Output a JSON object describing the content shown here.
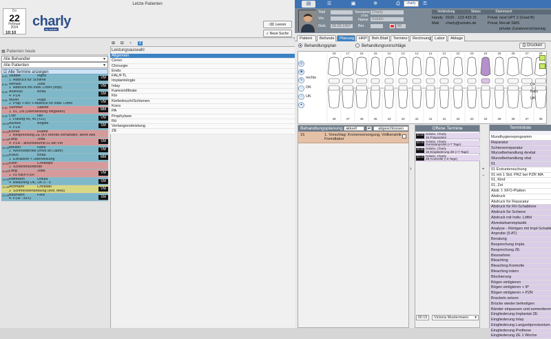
{
  "left_pane": {
    "title": "Letzte Patienten",
    "calendar": {
      "dow": "Do",
      "day": "22",
      "month": "Februar",
      "year": "2024"
    },
    "clock": "10:10",
    "logo": "charly",
    "logo_sub": "by solutio",
    "buttons": {
      "clear": "Leeren",
      "new_search": "Neue Suche"
    },
    "patients_today_label": "Patienten heute",
    "treater_filter": "Alle Behandler",
    "patient_filter": "Alle Patienten",
    "all_appointments_label": "Alle Termine anzeigen",
    "appointments": [
      {
        "time": "8:00",
        "last": "Stubbe",
        "first": "Ingrid",
        "num": "1",
        "desc": "Abdruck für Schiene",
        "code": "VM",
        "color": "b"
      },
      {
        "time": "8:30",
        "last": "Wenzel",
        "first": "Jutta",
        "num": "1",
        "desc": "Abdruck mit Indiv. Löffel (Impl)",
        "code": "VM",
        "color": "b"
      },
      {
        "time": "8:45",
        "last": "Andreas",
        "first": "Britta",
        "num": "4",
        "desc": "PZR",
        "code": "SM",
        "color": "b"
      },
      {
        "time": "9:00",
        "last": "Müller",
        "first": "Hugo",
        "num": "2",
        "desc": "Präp + eKr + Abdruck für indiv. Löffel",
        "code": "VM",
        "color": "b"
      },
      {
        "time": "9:30",
        "last": "Sommer",
        "first": "Sabine",
        "num": "1",
        "desc": "01, Zst (Überweisung mitgeben)",
        "code": "MM",
        "color": "r"
      },
      {
        "time": "9:45",
        "last": "Lutz",
        "first": "Ilse",
        "num": "1",
        "desc": "Füllung 46, 45 (+22)",
        "code": "VM",
        "color": "b"
      },
      {
        "time": "10:00",
        "last": "Aichele",
        "first": "Brigitte",
        "num": "4",
        "desc": "PZR",
        "code": "SM",
        "color": "b"
      },
      {
        "time": "10:00",
        "last": "Körner",
        "first": "Rudolf",
        "num": "1",
        "desc": "Besprechung ZE (KV bereits vorhanden, siehe Aktuell)",
        "code": "",
        "color": "r"
      },
      {
        "time": "10:30",
        "last": "Lang",
        "first": "Jutta",
        "num": "4",
        "desc": "PZR - anschließend 01 bei VM",
        "code": "SM",
        "color": "r"
      },
      {
        "time": "10:45",
        "last": "Meister",
        "first": "Hans",
        "num": "2",
        "desc": "Wechselprobe (Infos an Labor)",
        "code": "VM",
        "color": "b"
      },
      {
        "time": "11:00",
        "last": "Kraus",
        "first": "Britta",
        "num": "1",
        "desc": "Extraktion + Überweisung",
        "code": "MM",
        "color": "b"
      },
      {
        "time": "11:30",
        "last": "Klein",
        "first": "Christoph",
        "num": "1",
        "desc": "Schienenkontrolle",
        "code": "",
        "color": "r"
      },
      {
        "time": "11:45",
        "last": "Lang",
        "first": "Jutta",
        "num": "1",
        "desc": "01 nach PZR",
        "code": "VM",
        "color": "r"
      },
      {
        "time": "12:00",
        "last": "Hoffmann",
        "first": "Ursula",
        "num": "4",
        "desc": "Bleaching OK, UK 5 - 5",
        "code": "SM",
        "color": "b"
      },
      {
        "time": "12:30",
        "last": "Achmann",
        "first": "Christian",
        "num": "2",
        "desc": "Schmerzbehandlung (evtl. Med)",
        "code": "VM",
        "color": "y"
      },
      {
        "time": "12:45",
        "last": "Baumann",
        "first": "Felix",
        "num": "4",
        "desc": "PZR - KFO",
        "code": "SM",
        "color": "b"
      }
    ],
    "service_header": "Leistungsauswahl",
    "services": [
      "Allgemein",
      "Cerec",
      "Chirurgie",
      "Endo",
      "FAL/FTL",
      "Implantologie",
      "Inlay",
      "Kariesinfiltrate",
      "Klo",
      "Kieferbruch/Schienen",
      "Kons",
      "PA",
      "Prophylaxe",
      "Rö",
      "Verlangensleistung",
      "ZE"
    ]
  },
  "right_pane": {
    "charly_label": "charly",
    "patient": {
      "labels": {
        "title": "Titel",
        "first": "Vorname",
        "pre": "Vor.",
        "name": "Name",
        "dob": "Geb.",
        "ber": "Ber."
      },
      "first_name": "Charly",
      "last_name": "Solutio",
      "dob": "08.05.1967",
      "age": "56",
      "patnr": "2730"
    },
    "verbindung": {
      "label": "Verbindung",
      "status": "Status",
      "stamm": "Stammarzt"
    },
    "contact": {
      "handy_label": "Handy",
      "handy": "0100 - 123 433 21",
      "mail_label": "Mail",
      "mail": "charly@solutio.de",
      "ins_right1": "Privat",
      "ins_right2": "Privat",
      "ins_1": "next UPT 2 (Grad B)",
      "ins_2": "Recall SMS",
      "ins_3": "private Zusatzversicherung"
    },
    "tabs": [
      "Patient",
      "Befunde",
      "Planung",
      "HKP",
      "Beh.Blatt",
      "Termine",
      "Rechnung",
      "Labor",
      "Ablage"
    ],
    "active_tab": "Planung",
    "radio_plan": "Behandlungsplan",
    "radio_sugg": "Behandlungsvorschläge",
    "print_label": "Drucken",
    "chart": {
      "upper_teeth": [
        "18",
        "17",
        "16",
        "15",
        "14",
        "13",
        "12",
        "11",
        "21",
        "22",
        "23",
        "24",
        "25",
        "26",
        "27",
        "28"
      ],
      "lower_teeth": [
        "48",
        "47",
        "46",
        "45",
        "44",
        "43",
        "42",
        "41",
        "31",
        "32",
        "33",
        "34",
        "35",
        "36",
        "37",
        "38"
      ],
      "label_ok": "OK",
      "label_uk": "UK",
      "label_rechts": "rechts",
      "label_links": "links",
      "highlight_tooth": "24"
    },
    "plan_panel": {
      "header": "Behandlungsplanung",
      "status": "aktuell",
      "filter": "abgeschlossen",
      "row_num": "15",
      "row_text": "1. Vorschlag: Kronenversorgung, Vollkeramik Fremdlabor"
    },
    "open_appts": {
      "header": "Offene Termine",
      "items": [
        {
          "dur": "00:30",
          "name": "Solutio, Charly",
          "desc": "15 Präparation"
        },
        {
          "dur": "00:15",
          "name": "Solutio, Charly",
          "desc": "Gerüstanprobe (+7 Tage)"
        },
        {
          "dur": "00:30",
          "name": "Solutio, Charly",
          "desc": "15 Eingliederung ZE (+7 Tage)"
        },
        {
          "dur": "00:15",
          "name": "Solutio, Charly",
          "desc": "ZE Kontrolle (+3 Tage)"
        }
      ],
      "footer_time": "00:15",
      "footer_doctor": "Victoria Mustermann"
    },
    "appt_list": {
      "header": "Terminliste",
      "items": [
        "Mundhygieneprogramm",
        "Reparatur",
        "Schienenreparatur",
        "Wurzelbehandlung devital",
        "Wurzelbehandlung vital",
        "01",
        "01 Erstuntersuchung",
        "01 mit 1 Std. PRZ bei PZR MA",
        "01, Kind",
        "01, Zst",
        "Abdr. f. KFO-Platten",
        "Abdruck",
        "Abdruck für Reparatur",
        "Abdruck für Rö-Schablone",
        "Abdruck für Schiene",
        "Abdruck mit Indiv. Löffel",
        "Alveolarkammplastik",
        "Analyse - Röntgen mit Impl-Schablone",
        "Anprobe (5 AT)",
        "Beratung",
        "Besprechung Impla",
        "Besprechung ZE",
        "Bissnahme",
        "Bleaching",
        "Bleaching Kontrolle",
        "Bleaching intern",
        "Blockierung",
        "Bögen einligieren",
        "Bögen einligieren + IP",
        "Bögen einligieren + PZR",
        "Brackets setzen",
        "Brücke wieder befestigen",
        "Bänder einpassen und zementieren",
        "Eingliederung Implantat ZE",
        "Eingliederung Inlay",
        "Eingliederung Langzeitprovisorium",
        "Eingliederung Prothese",
        "Eingliederung ZE 1 Woche"
      ],
      "white_indices": [
        0,
        6,
        7,
        8,
        9,
        10,
        11,
        12
      ]
    }
  }
}
